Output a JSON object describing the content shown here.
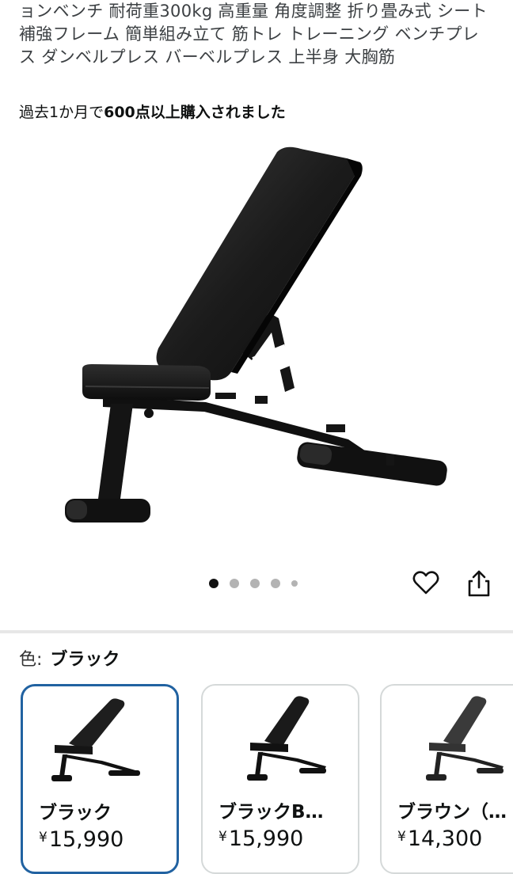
{
  "product": {
    "title": "ョンベンチ 耐荷重300kg 高重量 角度調整 折り畳み式 シート補強フレーム 簡単組み立て 筋トレ トレーニング ベンチプレス ダンベルプレス バーベルプレス 上半身 大胸筋",
    "purchased_prefix": "過去1か月で",
    "purchased_emphasis": "600点以上購入されました"
  },
  "gallery": {
    "image_count": 5,
    "active_index": 0
  },
  "actions": {
    "favorite_icon": "heart-outline-icon",
    "share_icon": "share-icon"
  },
  "color": {
    "label": "色:",
    "selected": "ブラック",
    "options": [
      {
        "name": "ブラック",
        "currency": "¥",
        "price": "15,990",
        "selected": true,
        "tone": "#1a1a1a"
      },
      {
        "name": "ブラックB…",
        "currency": "¥",
        "price": "15,990",
        "selected": false,
        "tone": "#1a1a1a"
      },
      {
        "name": "ブラウン（…",
        "currency": "¥",
        "price": "14,300",
        "selected": false,
        "tone": "#3a3a3a"
      }
    ]
  },
  "colors": {
    "selected_border": "#2162a1",
    "divider": "#e7e7e7",
    "dot_active": "#111111",
    "dot_inactive": "#b3b3b3"
  }
}
